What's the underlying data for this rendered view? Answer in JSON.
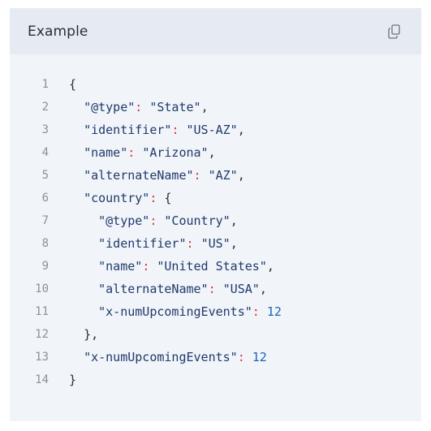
{
  "panel": {
    "title": "Example",
    "copy_icon": "copy-icon"
  },
  "code": {
    "lines": [
      {
        "num": "1",
        "indent": "",
        "parts": [
          {
            "t": "b",
            "v": "{"
          }
        ]
      },
      {
        "num": "2",
        "indent": "  ",
        "parts": [
          {
            "t": "k",
            "v": "\"@type\""
          },
          {
            "t": "p",
            "v": ":"
          },
          {
            "t": "b",
            "v": " "
          },
          {
            "t": "s",
            "v": "\"State\""
          },
          {
            "t": "b",
            "v": ","
          }
        ]
      },
      {
        "num": "3",
        "indent": "  ",
        "parts": [
          {
            "t": "k",
            "v": "\"identifier\""
          },
          {
            "t": "p",
            "v": ":"
          },
          {
            "t": "b",
            "v": " "
          },
          {
            "t": "s",
            "v": "\"US-AZ\""
          },
          {
            "t": "b",
            "v": ","
          }
        ]
      },
      {
        "num": "4",
        "indent": "  ",
        "parts": [
          {
            "t": "k",
            "v": "\"name\""
          },
          {
            "t": "p",
            "v": ":"
          },
          {
            "t": "b",
            "v": " "
          },
          {
            "t": "s",
            "v": "\"Arizona\""
          },
          {
            "t": "b",
            "v": ","
          }
        ]
      },
      {
        "num": "5",
        "indent": "  ",
        "parts": [
          {
            "t": "k",
            "v": "\"alternateName\""
          },
          {
            "t": "p",
            "v": ":"
          },
          {
            "t": "b",
            "v": " "
          },
          {
            "t": "s",
            "v": "\"AZ\""
          },
          {
            "t": "b",
            "v": ","
          }
        ]
      },
      {
        "num": "6",
        "indent": "  ",
        "parts": [
          {
            "t": "k",
            "v": "\"country\""
          },
          {
            "t": "p",
            "v": ":"
          },
          {
            "t": "b",
            "v": " {"
          }
        ]
      },
      {
        "num": "7",
        "indent": "    ",
        "parts": [
          {
            "t": "k",
            "v": "\"@type\""
          },
          {
            "t": "p",
            "v": ":"
          },
          {
            "t": "b",
            "v": " "
          },
          {
            "t": "s",
            "v": "\"Country\""
          },
          {
            "t": "b",
            "v": ","
          }
        ]
      },
      {
        "num": "8",
        "indent": "    ",
        "parts": [
          {
            "t": "k",
            "v": "\"identifier\""
          },
          {
            "t": "p",
            "v": ":"
          },
          {
            "t": "b",
            "v": " "
          },
          {
            "t": "s",
            "v": "\"US\""
          },
          {
            "t": "b",
            "v": ","
          }
        ]
      },
      {
        "num": "9",
        "indent": "    ",
        "parts": [
          {
            "t": "k",
            "v": "\"name\""
          },
          {
            "t": "p",
            "v": ":"
          },
          {
            "t": "b",
            "v": " "
          },
          {
            "t": "s",
            "v": "\"United States\""
          },
          {
            "t": "b",
            "v": ","
          }
        ]
      },
      {
        "num": "10",
        "indent": "    ",
        "parts": [
          {
            "t": "k",
            "v": "\"alternateName\""
          },
          {
            "t": "p",
            "v": ":"
          },
          {
            "t": "b",
            "v": " "
          },
          {
            "t": "s",
            "v": "\"USA\""
          },
          {
            "t": "b",
            "v": ","
          }
        ]
      },
      {
        "num": "11",
        "indent": "    ",
        "parts": [
          {
            "t": "k",
            "v": "\"x-numUpcomingEvents\""
          },
          {
            "t": "p",
            "v": ":"
          },
          {
            "t": "b",
            "v": " "
          },
          {
            "t": "n",
            "v": "12"
          }
        ]
      },
      {
        "num": "12",
        "indent": "  ",
        "parts": [
          {
            "t": "b",
            "v": "},"
          }
        ]
      },
      {
        "num": "13",
        "indent": "  ",
        "parts": [
          {
            "t": "k",
            "v": "\"x-numUpcomingEvents\""
          },
          {
            "t": "p",
            "v": ":"
          },
          {
            "t": "b",
            "v": " "
          },
          {
            "t": "n",
            "v": "12"
          }
        ]
      },
      {
        "num": "14",
        "indent": "",
        "parts": [
          {
            "t": "b",
            "v": "}"
          }
        ]
      }
    ]
  },
  "colors": {
    "panel_bg": "#f1f4f9",
    "header_bg": "#e6ebf3",
    "key": "#1f3a6b",
    "punctuation": "#d03a3a",
    "number": "#1a64b7",
    "line_number": "#8b919b"
  }
}
